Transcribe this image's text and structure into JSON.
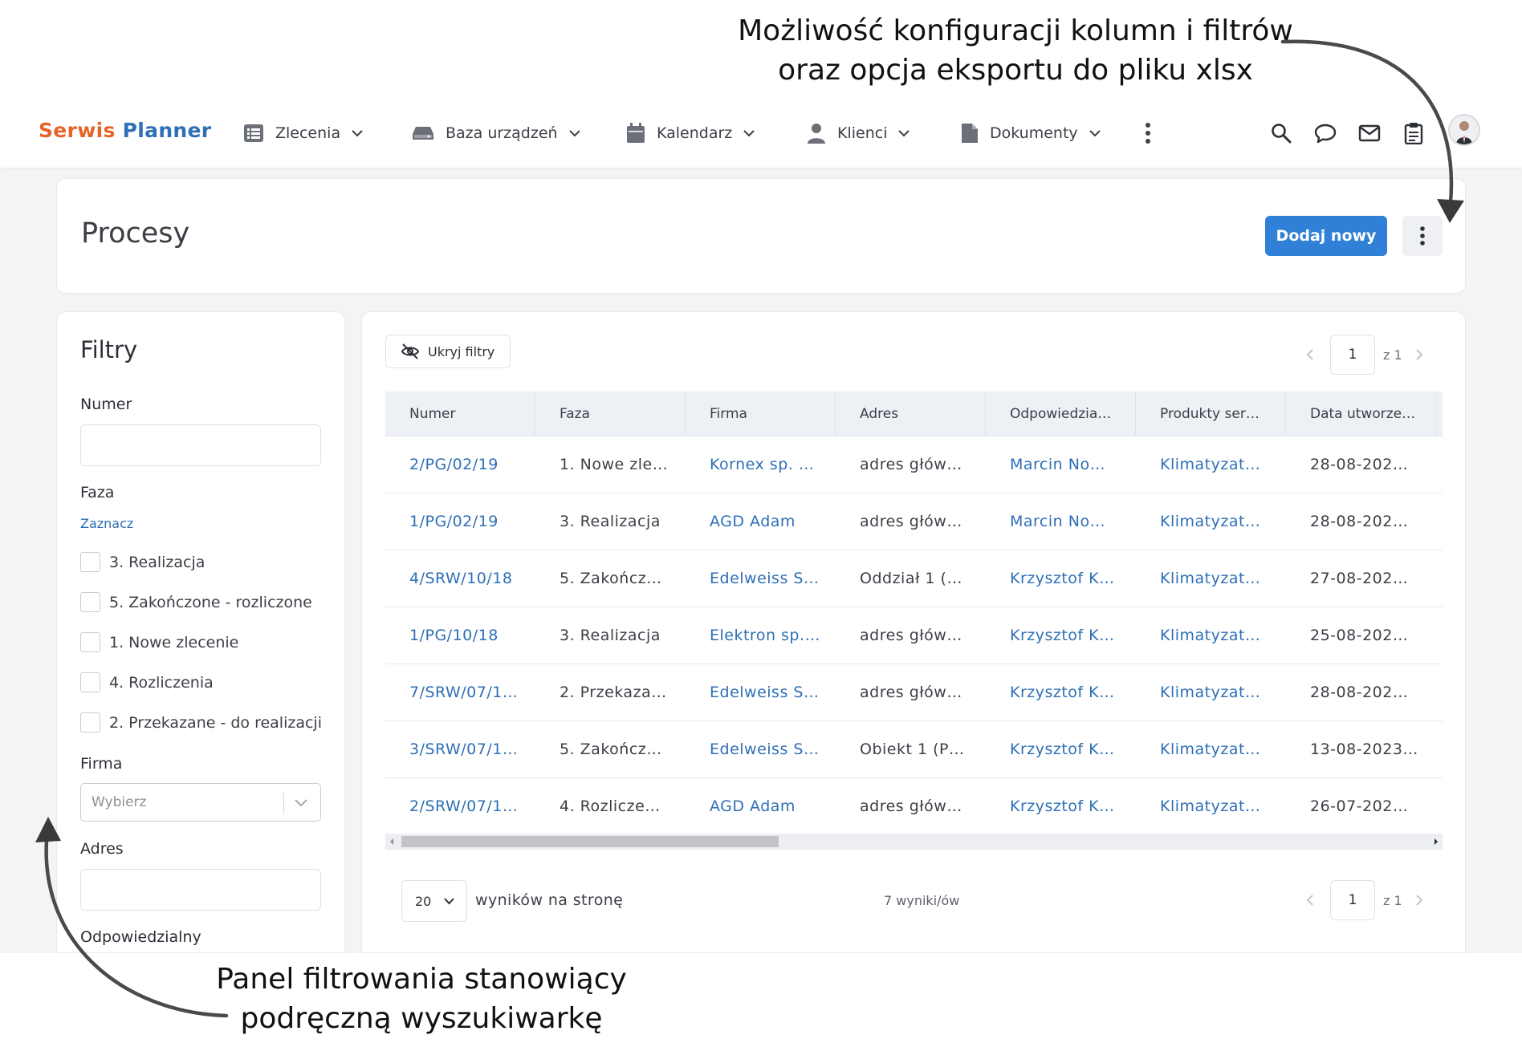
{
  "annotations": {
    "top_line1": "Możliwość konfiguracji kolumn i filtrów",
    "top_line2": "oraz opcja eksportu do pliku xlsx",
    "bottom_line1": "Panel filtrowania stanowiący",
    "bottom_line2": "podręczną wyszukiwarkę"
  },
  "brand": {
    "part1": "Serwis",
    "part2": "Planner",
    "color1": "#e6642a",
    "color2": "#2e6fb6"
  },
  "nav": {
    "items": [
      {
        "label": "Zlecenia",
        "icon": "list-icon"
      },
      {
        "label": "Baza urządzeń",
        "icon": "device-icon"
      },
      {
        "label": "Kalendarz",
        "icon": "calendar-icon"
      },
      {
        "label": "Klienci",
        "icon": "user-icon"
      },
      {
        "label": "Dokumenty",
        "icon": "document-icon"
      }
    ],
    "right_icons": [
      "search-icon",
      "chat-icon",
      "mail-icon",
      "clipboard-icon"
    ]
  },
  "page": {
    "title": "Procesy",
    "add_button": "Dodaj nowy",
    "accent": "#2f80d6"
  },
  "filters": {
    "title": "Filtry",
    "numer_label": "Numer",
    "numer_value": "",
    "faza_label": "Faza",
    "faza_select_link": "Zaznacz",
    "faza_options": [
      "3. Realizacja",
      "5. Zakończone - rozliczone",
      "1. Nowe zlecenie",
      "4. Rozliczenia",
      "2. Przekazane - do realizacji"
    ],
    "firma_label": "Firma",
    "firma_placeholder": "Wybierz",
    "adres_label": "Adres",
    "adres_value": "",
    "odpowiedzialny_label": "Odpowiedzialny"
  },
  "table": {
    "hide_filters": "Ukryj filtry",
    "page": "1",
    "page_total": "z 1",
    "columns": [
      "Numer",
      "Faza",
      "Firma",
      "Adres",
      "Odpowiedzia…",
      "Produkty ser…",
      "Data utworze…"
    ],
    "rows": [
      [
        "2/PG/02/19",
        "1. Nowe zle…",
        "Kornex sp. …",
        "adres głów…",
        "Marcin No…",
        "Klimatyzat…",
        "28-08-202…"
      ],
      [
        "1/PG/02/19",
        "3. Realizacja",
        "AGD Adam",
        "adres głów…",
        "Marcin No…",
        "Klimatyzat…",
        "28-08-202…"
      ],
      [
        "4/SRW/10/18",
        "5. Zakończ…",
        "Edelweiss S…",
        "Oddział 1 (…",
        "Krzysztof K…",
        "Klimatyzat…",
        "27-08-202…"
      ],
      [
        "1/PG/10/18",
        "3. Realizacja",
        "Elektron sp.…",
        "adres głów…",
        "Krzysztof K…",
        "Klimatyzat…",
        "25-08-202…"
      ],
      [
        "7/SRW/07/1…",
        "2. Przekaza…",
        "Edelweiss S…",
        "adres głów…",
        "Krzysztof K…",
        "Klimatyzat…",
        "28-08-202…"
      ],
      [
        "3/SRW/07/1…",
        "5. Zakończ…",
        "Edelweiss S…",
        "Obiekt 1 (P…",
        "Krzysztof K…",
        "Klimatyzat…",
        "13-08-2023…"
      ],
      [
        "2/SRW/07/1…",
        "4. Rozlicze…",
        "AGD Adam",
        "adres głów…",
        "Krzysztof K…",
        "Klimatyzat…",
        "26-07-202…"
      ]
    ],
    "link_columns": [
      0,
      2,
      4,
      5
    ],
    "per_page": "20",
    "per_page_label": "wyników na stronę",
    "results": "7 wyniki/ów"
  }
}
